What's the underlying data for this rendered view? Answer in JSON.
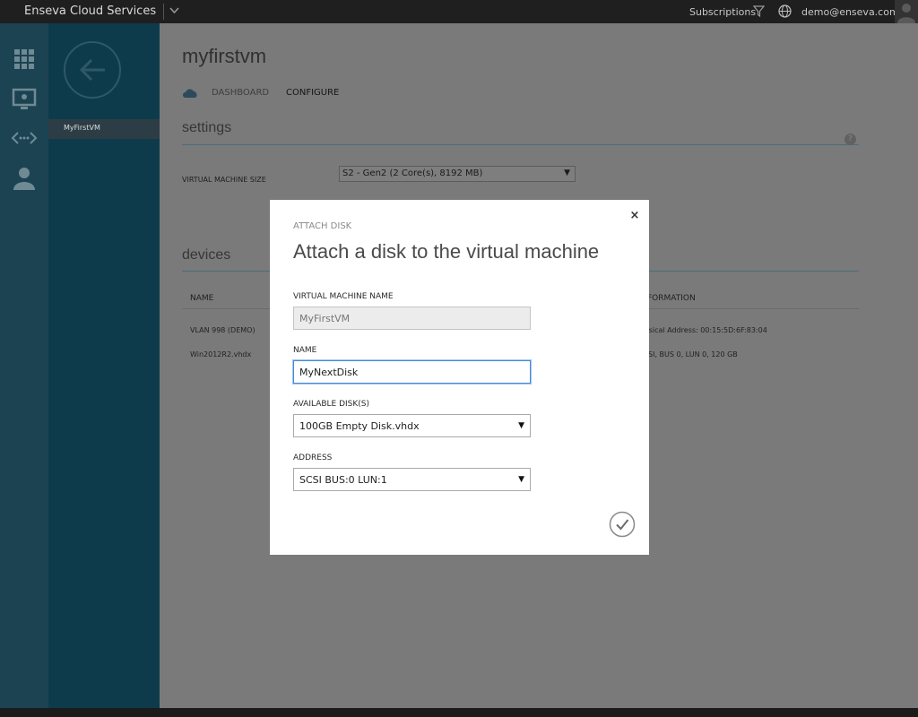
{
  "topbar": {
    "brand": "Enseva Cloud Services",
    "subscriptions": "Subscriptions",
    "email": "demo@enseva.com",
    "icons": [
      "chevron-down-icon",
      "filter-icon",
      "globe-icon",
      "user-avatar"
    ]
  },
  "nav": {
    "icons": [
      "grid-icon",
      "monitor-icon",
      "network-icon",
      "user-icon"
    ],
    "back_icon": "back-arrow-icon",
    "flyout_item": "MyFirstVM"
  },
  "page": {
    "title": "myfirstvm",
    "tabs": [
      {
        "label": "DASHBOARD",
        "icon": "cloud-icon"
      },
      {
        "label": "CONFIGURE"
      }
    ],
    "settings": {
      "heading": "settings",
      "help": "?",
      "vm_size_label": "VIRTUAL MACHINE SIZE",
      "vm_size_value": "S2 - Gen2 (2 Core(s), 8192 MB)"
    },
    "devices": {
      "heading": "devices",
      "columns": [
        "NAME",
        "FORMATION"
      ],
      "rows": [
        {
          "name": "VLAN 998 (DEMO)",
          "info": "ysical Address: 00:15:5D:6F:83:04"
        },
        {
          "name": "Win2012R2.vhdx",
          "info": "SI, BUS 0, LUN 0, 120 GB"
        }
      ]
    }
  },
  "dialog": {
    "kicker": "ATTACH DISK",
    "title": "Attach a disk to the virtual machine",
    "close": "×",
    "fields": {
      "vm_name": {
        "label": "VIRTUAL MACHINE NAME",
        "value": "MyFirstVM"
      },
      "name": {
        "label": "NAME",
        "value": "MyNextDisk"
      },
      "disk": {
        "label": "AVAILABLE DISK(S)",
        "value": "100GB Empty Disk.vhdx"
      },
      "address": {
        "label": "ADDRESS",
        "value": "SCSI BUS:0 LUN:1"
      }
    },
    "ok_icon": "checkmark-icon"
  },
  "colors": {
    "accent": "#4a89d6",
    "nav": "#1c4352",
    "overlay": "#7a7a7a"
  }
}
